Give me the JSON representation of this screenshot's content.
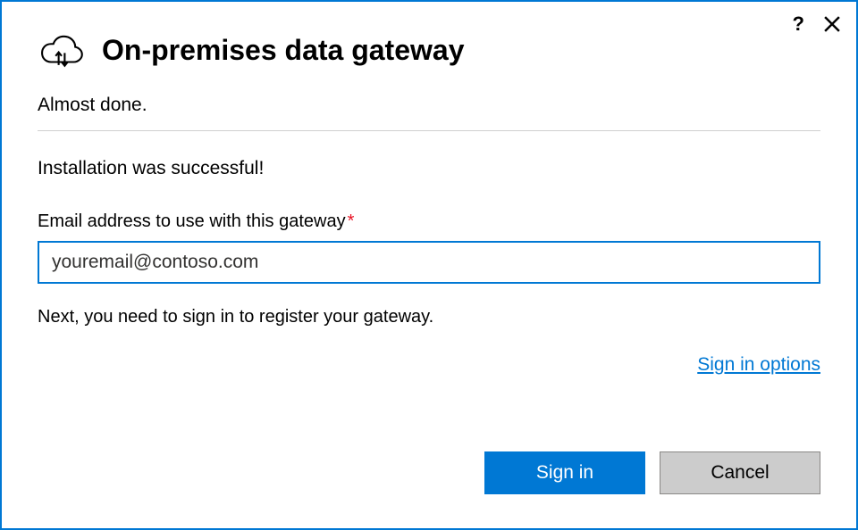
{
  "titlebar": {
    "help_glyph": "?"
  },
  "header": {
    "title": "On-premises data gateway"
  },
  "body": {
    "subtitle": "Almost done.",
    "success_message": "Installation was successful!",
    "email_label": "Email address to use with this gateway",
    "required_mark": "*",
    "email_value": "youremail@contoso.com",
    "next_instruction": "Next, you need to sign in to register your gateway.",
    "signin_options_label": "Sign in options"
  },
  "buttons": {
    "signin": "Sign in",
    "cancel": "Cancel"
  }
}
